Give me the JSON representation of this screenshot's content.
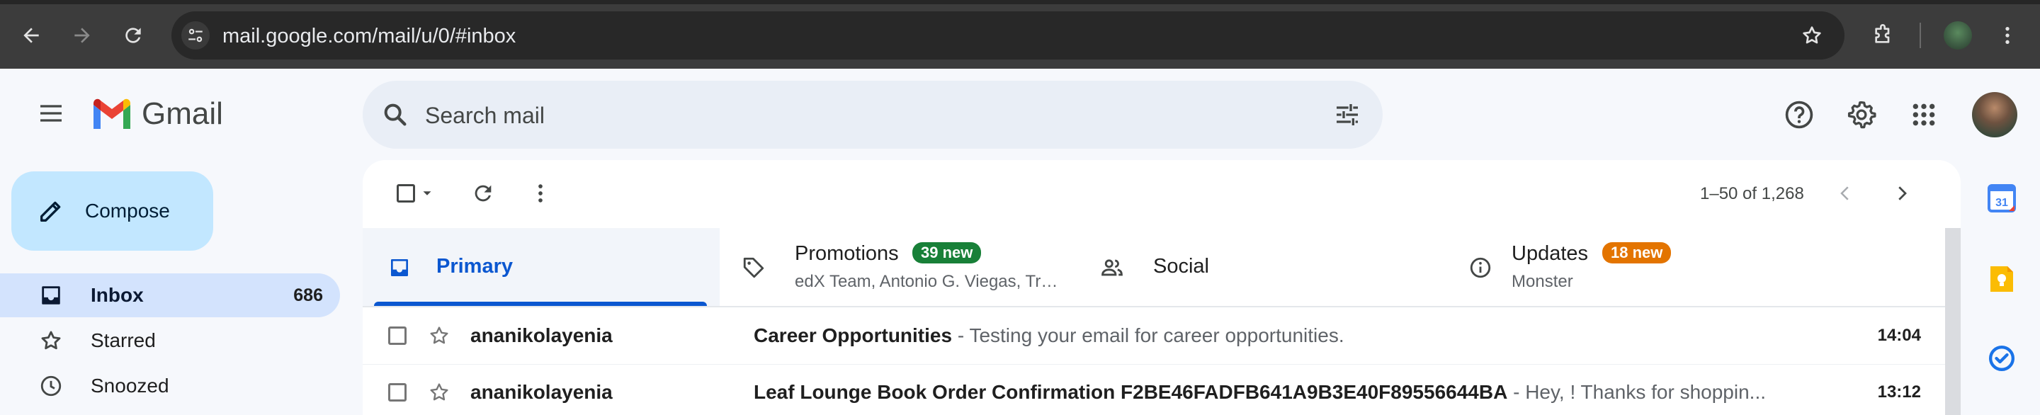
{
  "browser": {
    "url": "mail.google.com/mail/u/0/#inbox",
    "icons": [
      "back-icon",
      "forward-icon",
      "reload-icon",
      "site-info-icon",
      "bookmark-star-icon",
      "extensions-icon",
      "profile-avatar"
    ]
  },
  "header": {
    "app_name": "Gmail",
    "search_placeholder": "Search mail",
    "icons": [
      "main-menu-icon",
      "search-icon",
      "search-options-icon",
      "help-icon",
      "settings-icon",
      "apps-icon",
      "account-avatar"
    ]
  },
  "sidebar": {
    "compose_label": "Compose",
    "items": [
      {
        "label": "Inbox",
        "count": "686",
        "icon": "inbox-icon",
        "active": true
      },
      {
        "label": "Starred",
        "count": "",
        "icon": "star-icon",
        "active": false
      },
      {
        "label": "Snoozed",
        "count": "",
        "icon": "clock-icon",
        "active": false
      }
    ]
  },
  "toolbar": {
    "pagination": "1–50 of 1,268",
    "icons": [
      "select-all-checkbox",
      "select-dropdown-icon",
      "refresh-icon",
      "more-options-icon",
      "newer-page-icon",
      "older-page-icon"
    ]
  },
  "tabs": [
    {
      "label": "Primary",
      "badge": "",
      "subtitle": "",
      "icon": "inbox-tab-icon",
      "active": true
    },
    {
      "label": "Promotions",
      "badge": "39 new",
      "subtitle": "edX Team, Antonio G. Viegas, Tr…",
      "icon": "tag-icon",
      "active": false
    },
    {
      "label": "Social",
      "badge": "",
      "subtitle": "",
      "icon": "people-icon",
      "active": false
    },
    {
      "label": "Updates",
      "badge": "18 new",
      "subtitle": "Monster",
      "icon": "info-icon",
      "active": false
    }
  ],
  "emails": [
    {
      "sender": "ananikolayenia",
      "subject": "Career Opportunities",
      "separator": " - ",
      "snippet": "Testing your email for career opportunities.",
      "time": "14:04"
    },
    {
      "sender": "ananikolayenia",
      "subject": "Leaf Lounge Book Order Confirmation F2BE46FADFB641A9B3E40F89556644BA",
      "separator": " - ",
      "snippet": "Hey, ! Thanks for shoppin...",
      "time": "13:12"
    }
  ],
  "side_panel": {
    "apps": [
      "calendar-app-icon",
      "keep-app-icon",
      "tasks-app-icon"
    ],
    "calendar_day": "31"
  },
  "colors": {
    "compose_bg": "#c2e7ff",
    "active_nav_bg": "#d3e3fd",
    "primary_accent": "#0b57d0",
    "promotions_badge": "#188038",
    "updates_badge": "#e37400",
    "search_bg": "#e9eef6",
    "chrome_bg": "#3c3c3c"
  }
}
